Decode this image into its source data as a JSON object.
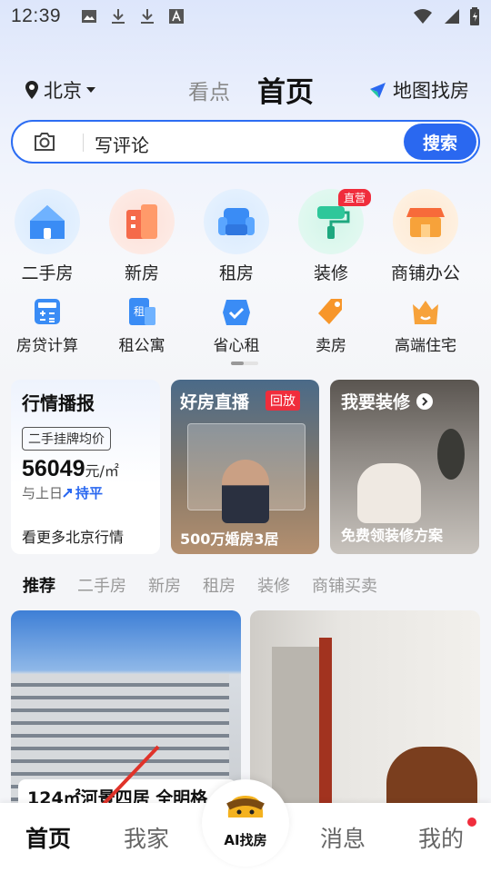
{
  "status": {
    "time": "12:39"
  },
  "header": {
    "city": "北京",
    "tab_look": "看点",
    "tab_home": "首页",
    "map_find": "地图找房"
  },
  "search": {
    "placeholder": "写评论",
    "button": "搜索"
  },
  "categories": [
    {
      "label": "二手房",
      "icon": "house-icon",
      "color": "#3a8cf5"
    },
    {
      "label": "新房",
      "icon": "building-icon",
      "color": "#f56a4a"
    },
    {
      "label": "租房",
      "icon": "sofa-icon",
      "color": "#3a8cf5"
    },
    {
      "label": "装修",
      "icon": "paint-roller-icon",
      "color": "#2ec79a",
      "badge": "直营"
    },
    {
      "label": "商铺办公",
      "icon": "shop-icon",
      "color": "#f7a23a"
    }
  ],
  "subcategories": [
    {
      "label": "房贷计算",
      "icon": "calculator-icon"
    },
    {
      "label": "租公寓",
      "icon": "apartment-icon",
      "glyph": "租"
    },
    {
      "label": "省心租",
      "icon": "check-box-icon"
    },
    {
      "label": "卖房",
      "icon": "price-tag-icon"
    },
    {
      "label": "高端住宅",
      "icon": "crown-house-icon"
    }
  ],
  "market": {
    "title": "行情播报",
    "tag": "二手挂牌均价",
    "price": "56049",
    "unit": "元/㎡",
    "compare_prefix": "与上日",
    "compare_value": "持平",
    "more": "看更多北京行情"
  },
  "live": {
    "title": "好房直播",
    "badge": "回放",
    "caption": "500万婚房3居"
  },
  "decor": {
    "title": "我要装修",
    "caption": "免费领装修方案"
  },
  "feed_tabs": [
    "推荐",
    "二手房",
    "新房",
    "租房",
    "装修",
    "商铺买卖"
  ],
  "feed": [
    {
      "caption": "124㎡河景四居 全明格"
    }
  ],
  "nav": {
    "home": "首页",
    "my_home": "我家",
    "ai": "AI找房",
    "messages": "消息",
    "mine": "我的"
  }
}
